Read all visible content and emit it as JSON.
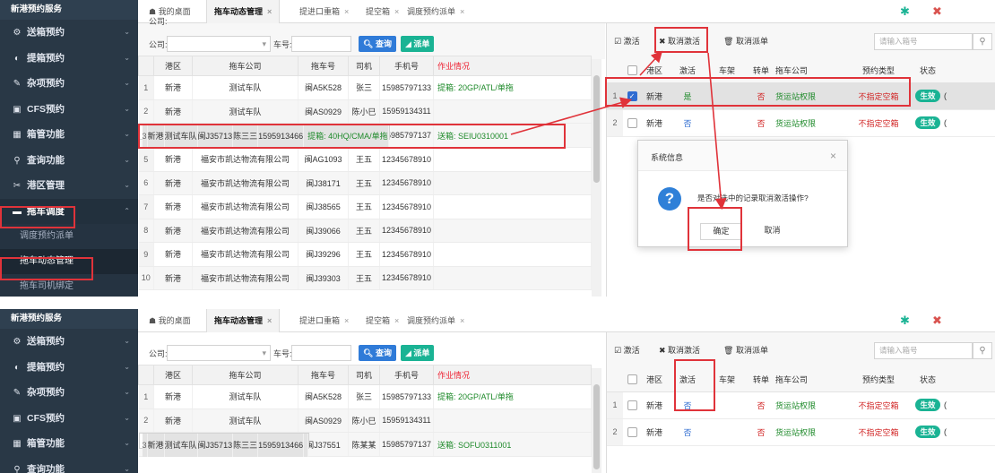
{
  "app_title": "新港预约服务",
  "sidebar": {
    "items": [
      {
        "icon": "⚙",
        "label": "送箱预约"
      },
      {
        "icon": "◐",
        "label": "提箱预约"
      },
      {
        "icon": "✎",
        "label": "杂项预约"
      },
      {
        "icon": "▣",
        "label": "CFS预约"
      },
      {
        "icon": "▦",
        "label": "箱管功能"
      },
      {
        "icon": "⚲",
        "label": "查询功能"
      },
      {
        "icon": "✂",
        "label": "港区管理"
      },
      {
        "icon": "▬",
        "label": "拖车调度"
      }
    ],
    "sub_items": [
      {
        "label": "调度预约派单"
      },
      {
        "label": "拖车动态管理"
      },
      {
        "label": "拖车司机绑定"
      }
    ]
  },
  "tabs": [
    {
      "label": "我的桌面"
    },
    {
      "label": "拖车动态管理"
    },
    {
      "label": "提进口重箱"
    },
    {
      "label": "提空箱"
    },
    {
      "label": "调度预约派单"
    }
  ],
  "left": {
    "company_label": "公司:",
    "plate_label": "车号:",
    "query_btn": "查询",
    "dispatch_btn": "派单",
    "columns": [
      "港区",
      "拖车公司",
      "拖车号",
      "司机",
      "手机号",
      "作业情况"
    ],
    "rows": [
      {
        "n": "1",
        "port": "新港",
        "company": "测试车队",
        "plate": "闽A5K528",
        "driver": "张三",
        "phone": "15985797133",
        "status": "提箱: 20GP/ATL/单拖"
      },
      {
        "n": "2",
        "port": "新港",
        "company": "测试车队",
        "plate": "闽AS0929",
        "driver": "陈小巳",
        "phone": "15959134311",
        "status": ""
      },
      {
        "n": "3",
        "port": "新港",
        "company": "测试车队",
        "plate": "闽J35713",
        "driver": "陈三三",
        "phone": "1595913466",
        "status": "提箱: 40HQ/CMA/单拖"
      },
      {
        "n": "4",
        "port": "新港",
        "company": "测试车队",
        "plate": "闽J37551",
        "driver": "陈某某",
        "phone": "15985797137",
        "status": "送箱: SEIU0310001"
      },
      {
        "n": "5",
        "port": "新港",
        "company": "福安市凯达物流有限公司",
        "plate": "闽AG1093",
        "driver": "王五",
        "phone": "12345678910",
        "status": ""
      },
      {
        "n": "6",
        "port": "新港",
        "company": "福安市凯达物流有限公司",
        "plate": "闽J38171",
        "driver": "王五",
        "phone": "12345678910",
        "status": ""
      },
      {
        "n": "7",
        "port": "新港",
        "company": "福安市凯达物流有限公司",
        "plate": "闽J38565",
        "driver": "王五",
        "phone": "12345678910",
        "status": ""
      },
      {
        "n": "8",
        "port": "新港",
        "company": "福安市凯达物流有限公司",
        "plate": "闽J39066",
        "driver": "王五",
        "phone": "12345678910",
        "status": ""
      },
      {
        "n": "9",
        "port": "新港",
        "company": "福安市凯达物流有限公司",
        "plate": "闽J39296",
        "driver": "王五",
        "phone": "12345678910",
        "status": ""
      },
      {
        "n": "10",
        "port": "新港",
        "company": "福安市凯达物流有限公司",
        "plate": "闽J39303",
        "driver": "王五",
        "phone": "12345678910",
        "status": ""
      }
    ]
  },
  "right": {
    "activate_btn": "激活",
    "cancel_activate_btn": "取消激活",
    "cancel_dispatch_btn": "取消派单",
    "search_placeholder": "请输入箱号",
    "columns": [
      "港区",
      "激活",
      "车架",
      "转单",
      "拖车公司",
      "预约类型",
      "状态"
    ],
    "rows": [
      {
        "n": "1",
        "port": "新港",
        "active": "是",
        "frame": "",
        "transfer": "否",
        "company": "货运站权限",
        "type": "不指定空箱",
        "state": "生效",
        "extra": "("
      },
      {
        "n": "2",
        "port": "新港",
        "active": "否",
        "frame": "",
        "transfer": "否",
        "company": "货运站权限",
        "type": "不指定空箱",
        "state": "生效",
        "extra": "("
      }
    ]
  },
  "dialog": {
    "title": "系统信息",
    "message": "是否对选中的记录取消激活操作?",
    "ok": "确定",
    "cancel": "取消"
  },
  "after": {
    "left_rows": [
      {
        "n": "1",
        "port": "新港",
        "company": "测试车队",
        "plate": "闽A5K528",
        "driver": "张三",
        "phone": "15985797133",
        "status": "提箱: 20GP/ATL/单拖"
      },
      {
        "n": "2",
        "port": "新港",
        "company": "测试车队",
        "plate": "闽AS0929",
        "driver": "陈小巳",
        "phone": "15959134311",
        "status": ""
      },
      {
        "n": "3",
        "port": "新港",
        "company": "测试车队",
        "plate": "闽J35713",
        "driver": "陈三三",
        "phone": "1595913466",
        "status": ""
      },
      {
        "n": "4",
        "port": "新港",
        "company": "测试车队",
        "plate": "闽J37551",
        "driver": "陈某某",
        "phone": "15985797137",
        "status": "送箱: SOFU0311001"
      }
    ],
    "right_rows": [
      {
        "n": "1",
        "port": "新港",
        "active": "否",
        "frame": "",
        "transfer": "否",
        "company": "货运站权限",
        "type": "不指定空箱",
        "state": "生效",
        "extra": "("
      },
      {
        "n": "2",
        "port": "新港",
        "active": "否",
        "frame": "",
        "transfer": "否",
        "company": "货运站权限",
        "type": "不指定空箱",
        "state": "生效",
        "extra": "("
      }
    ]
  },
  "colors": {
    "highlight": "#e0333a",
    "sidebar_bg": "#293846",
    "accent_blue": "#2f7bd8",
    "accent_green": "#1ab394"
  }
}
